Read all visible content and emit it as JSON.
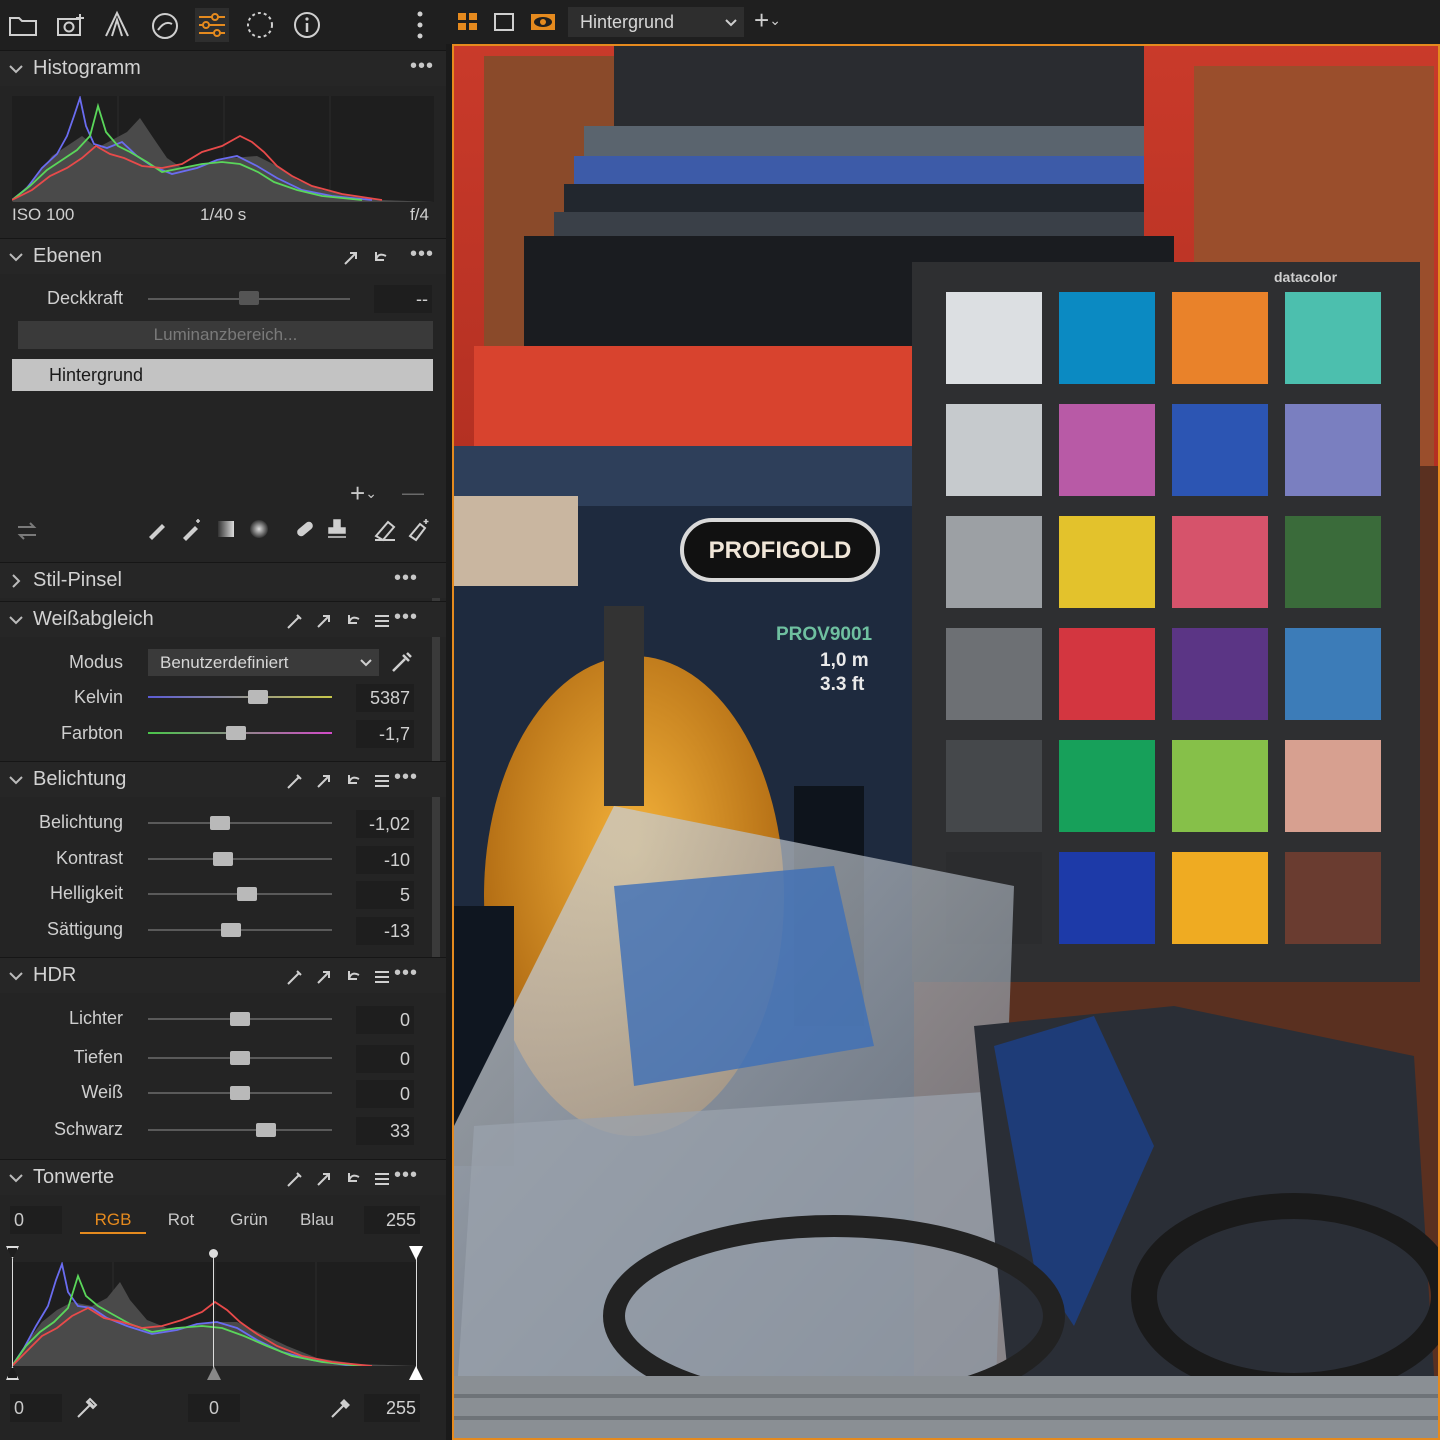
{
  "toolbar": {
    "icons": [
      "folder-icon",
      "camera-icon",
      "lens-icon",
      "color-icon",
      "sliders-icon",
      "lasso-icon",
      "info-icon",
      "kebab-icon"
    ],
    "view_tab": "Hintergrund",
    "add": "+"
  },
  "histogram": {
    "title": "Histogramm",
    "iso": "ISO 100",
    "shutter": "1/40 s",
    "aperture": "f/4"
  },
  "layers": {
    "title": "Ebenen",
    "opacity_label": "Deckkraft",
    "opacity_value": "--",
    "luminance_button": "Luminanzbereich...",
    "background_layer": "Hintergrund",
    "add_label": "+",
    "remove_label": "—"
  },
  "style_brush": {
    "title": "Stil-Pinsel"
  },
  "white_balance": {
    "title": "Weißabgleich",
    "mode_label": "Modus",
    "mode_value": "Benutzerdefiniert",
    "kelvin_label": "Kelvin",
    "kelvin_value": "5387",
    "kelvin_level": 0.6,
    "tint_label": "Farbton",
    "tint_value": "-1,7",
    "tint_level": 0.48
  },
  "exposure": {
    "title": "Belichtung",
    "rows": [
      {
        "label": "Belichtung",
        "value": "-1,02",
        "level": 0.39
      },
      {
        "label": "Kontrast",
        "value": "-10",
        "level": 0.41
      },
      {
        "label": "Helligkeit",
        "value": "5",
        "level": 0.54
      },
      {
        "label": "Sättigung",
        "value": "-13",
        "level": 0.45
      }
    ]
  },
  "hdr": {
    "title": "HDR",
    "rows": [
      {
        "label": "Lichter",
        "value": "0",
        "level": 0.5
      },
      {
        "label": "Tiefen",
        "value": "0",
        "level": 0.5
      },
      {
        "label": "Weiß",
        "value": "0",
        "level": 0.5
      },
      {
        "label": "Schwarz",
        "value": "33",
        "level": 0.64
      }
    ]
  },
  "levels": {
    "title": "Tonwerte",
    "input_min": "0",
    "input_max": "255",
    "channels": [
      "RGB",
      "Rot",
      "Grün",
      "Blau"
    ],
    "active_channel": "RGB",
    "output_min": "0",
    "output_mid": "0",
    "output_max": "255"
  },
  "photo": {
    "brand_label": "PROFIGOLD",
    "product_code": "PROV9001",
    "length_m": "1,0 m",
    "length_ft": "3.3 ft",
    "chart_brand": "datacolor",
    "patches": [
      "#dcdfe2",
      "#0b8ac2",
      "#e9822a",
      "#4cbfae",
      "#c6cacd",
      "#b85aa6",
      "#2c55b3",
      "#7a7fc0",
      "#9ca0a4",
      "#e3c22c",
      "#d6536b",
      "#3a6b3a",
      "#6d7074",
      "#d33640",
      "#5b3585",
      "#3c7cb8",
      "#45484b",
      "#17a05a",
      "#86c049",
      "#d7a090",
      "#2b2c2e",
      "#1d3aa8",
      "#efab22",
      "#6a3c30"
    ]
  },
  "colors": {
    "accent": "#e58a1e",
    "panel": "#242424",
    "levels_active": "#e58a1e"
  }
}
